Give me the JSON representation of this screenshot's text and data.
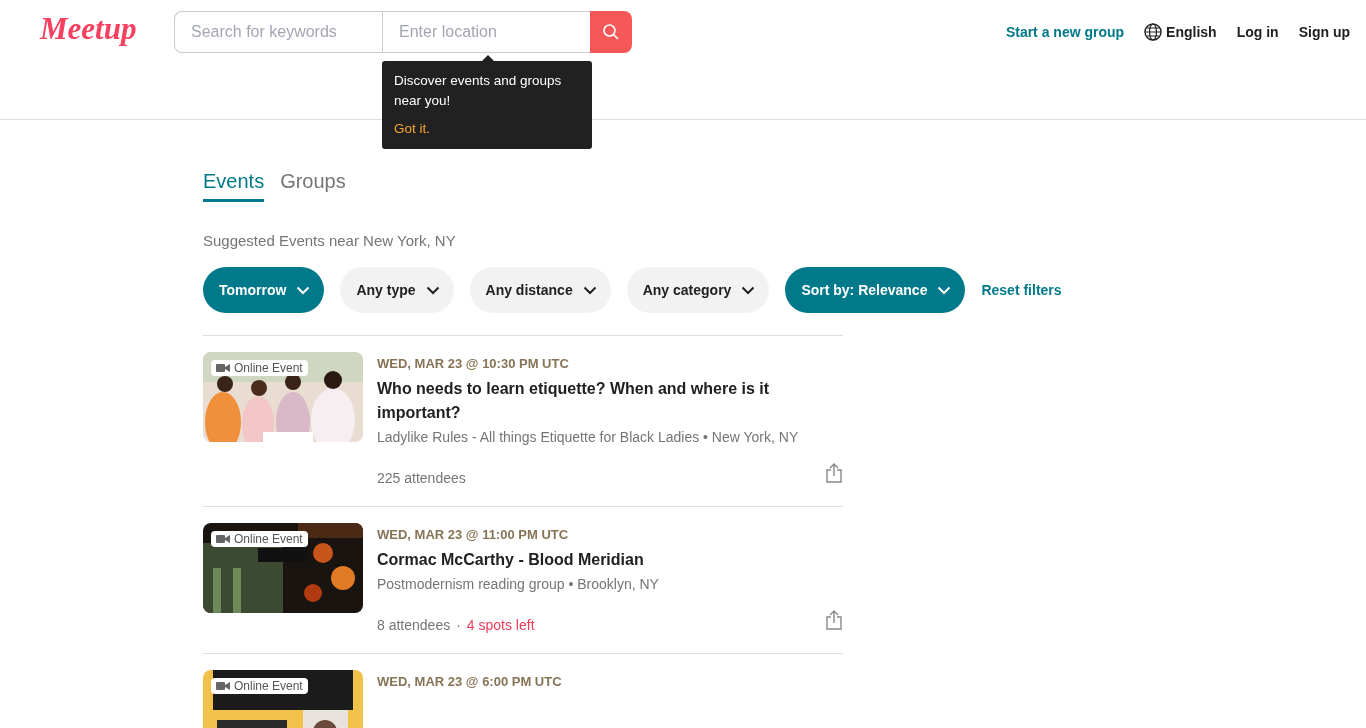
{
  "header": {
    "logo": "Meetup",
    "search": {
      "placeholder": "Search for keywords"
    },
    "location": {
      "placeholder": "Enter location"
    },
    "nav": [
      {
        "label": "Start a new group",
        "kind": "accent"
      },
      {
        "label": "English",
        "kind": "language"
      },
      {
        "label": "Log in",
        "kind": "plain"
      },
      {
        "label": "Sign up",
        "kind": "plain"
      }
    ]
  },
  "tooltip": {
    "text": "Discover events and groups near you!",
    "action": "Got it."
  },
  "tabs": [
    {
      "label": "Events",
      "selected": true
    },
    {
      "label": "Groups",
      "selected": false
    }
  ],
  "subtitle": "Suggested Events near New York, NY",
  "filters": [
    {
      "label": "Tomorrow",
      "active": true
    },
    {
      "label": "Any type",
      "active": false
    },
    {
      "label": "Any distance",
      "active": false
    },
    {
      "label": "Any category",
      "active": false
    },
    {
      "label": "Sort by: Relevance",
      "active": true
    }
  ],
  "reset": "Reset filters",
  "events": [
    {
      "badge": "Online Event",
      "date": "WED, MAR 23 @ 10:30 PM UTC",
      "title": "Who needs to learn etiquette? When and where is it important?",
      "group": "Ladylike Rules - All things Etiquette for Black Ladies • New York, NY",
      "attendees": "225 attendees"
    },
    {
      "badge": "Online Event",
      "date": "WED, MAR 23 @ 11:00 PM UTC",
      "title": "Cormac McCarthy - Blood Meridian",
      "group": "Postmodernism reading group • Brooklyn, NY",
      "attendees": "8 attendees",
      "separator": "·",
      "spots": "4 spots left"
    },
    {
      "badge": "Online Event",
      "date": "WED, MAR 23 @ 6:00 PM UTC"
    }
  ]
}
